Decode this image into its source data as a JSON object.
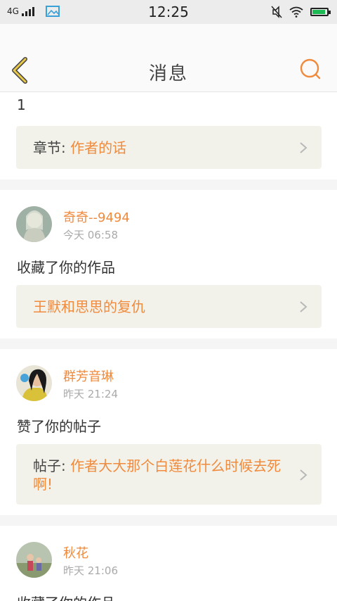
{
  "status_bar": {
    "network": "4G",
    "time": "12:25"
  },
  "header": {
    "title": "消息",
    "back_icon": "chevron-left-icon",
    "search_icon": "search-icon"
  },
  "messages": [
    {
      "partial_text": "1",
      "link_label": "章节:",
      "link_value": "作者的话"
    },
    {
      "user": "奇奇--9494",
      "time": "今天 06:58",
      "action": "收藏了你的作品",
      "link_value": "王默和思思的复仇"
    },
    {
      "user": "群芳音琳",
      "time": "昨天 21:24",
      "action": "赞了你的帖子",
      "link_label": "帖子:",
      "link_value": "作者大大那个白莲花什么时候去死啊!"
    },
    {
      "user": "秋花",
      "time": "昨天 21:06",
      "action": "收藏了你的作品"
    }
  ],
  "colors": {
    "accent": "#f08a3c",
    "back_icon": "#e8c94a",
    "link_bg": "#f3f2ea"
  }
}
